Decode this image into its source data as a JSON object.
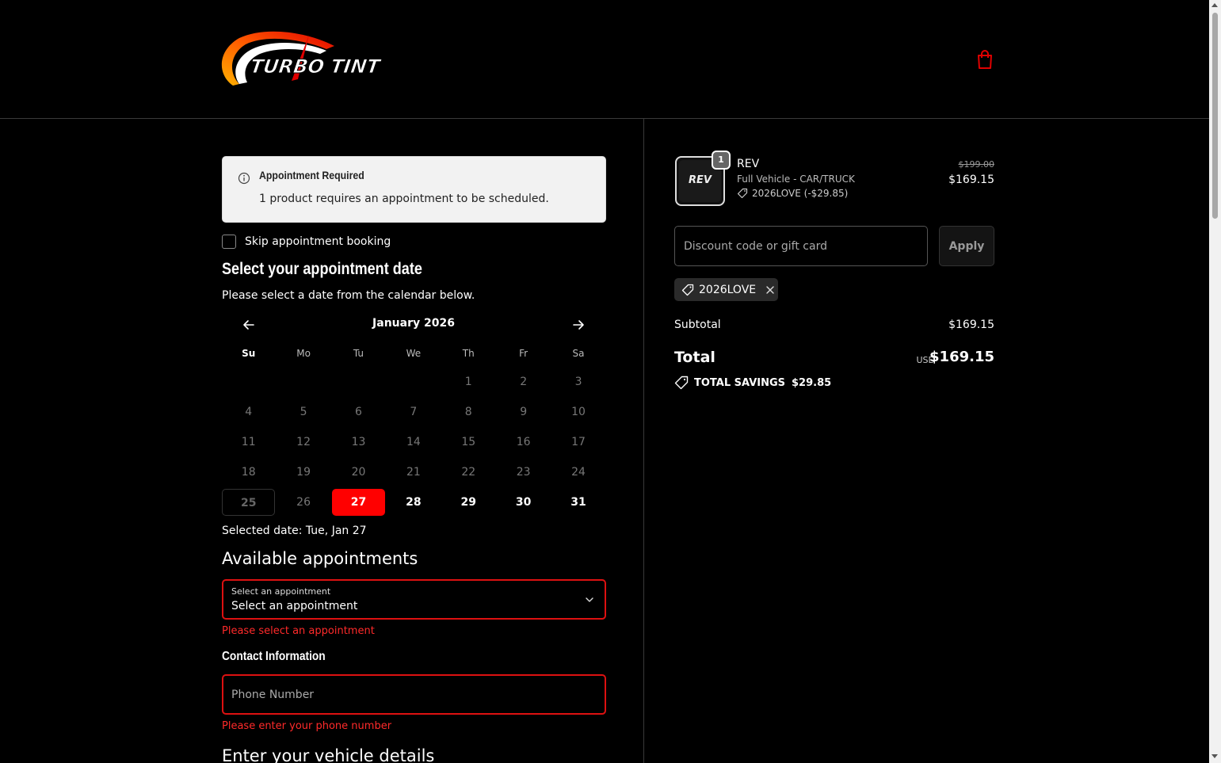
{
  "brand": {
    "name": "TURBO TINT"
  },
  "colors": {
    "accent": "#ff0000",
    "error": "#ff2a2a",
    "background": "#000000"
  },
  "alert": {
    "title": "Appointment Required",
    "body": "1 product requires an appointment to be scheduled."
  },
  "skip": {
    "label": "Skip appointment booking",
    "checked": false
  },
  "date_section": {
    "title": "Select your appointment date",
    "subtitle": "Please select a date from the calendar below."
  },
  "calendar": {
    "month_label": "January 2026",
    "weekdays": [
      "Su",
      "Mo",
      "Tu",
      "We",
      "Th",
      "Fr",
      "Sa"
    ],
    "weeks": [
      [
        "",
        "",
        "",
        "",
        "1",
        "2",
        "3"
      ],
      [
        "4",
        "5",
        "6",
        "7",
        "8",
        "9",
        "10"
      ],
      [
        "11",
        "12",
        "13",
        "14",
        "15",
        "16",
        "17"
      ],
      [
        "18",
        "19",
        "20",
        "21",
        "22",
        "23",
        "24"
      ],
      [
        "25",
        "26",
        "27",
        "28",
        "29",
        "30",
        "31"
      ]
    ],
    "today": "25",
    "selected": "27",
    "available": [
      "27",
      "28",
      "29",
      "30",
      "31"
    ]
  },
  "selected_date_text": "Selected date: Tue, Jan 27",
  "appointments": {
    "title": "Available appointments",
    "caption": "Select an appointment",
    "value": "Select an appointment",
    "error": "Please select an appointment"
  },
  "contact": {
    "title": "Contact Information",
    "phone_placeholder": "Phone Number",
    "phone_error": "Please enter your phone number"
  },
  "vehicle": {
    "title": "Enter your vehicle details"
  },
  "order": {
    "item": {
      "thumb_label": "REV",
      "quantity": "1",
      "name": "REV",
      "variant": "Full Vehicle - CAR/TRUCK",
      "discount": "2026LOVE (-$29.85)",
      "price_original": "$199.00",
      "price": "$169.15"
    },
    "discount_placeholder": "Discount code or gift card",
    "apply_label": "Apply",
    "applied_code": "2026LOVE",
    "subtotal_label": "Subtotal",
    "subtotal": "$169.15",
    "total_label": "Total",
    "currency": "USD",
    "total": "$169.15",
    "savings_label": "TOTAL SAVINGS",
    "savings": "$29.85"
  }
}
